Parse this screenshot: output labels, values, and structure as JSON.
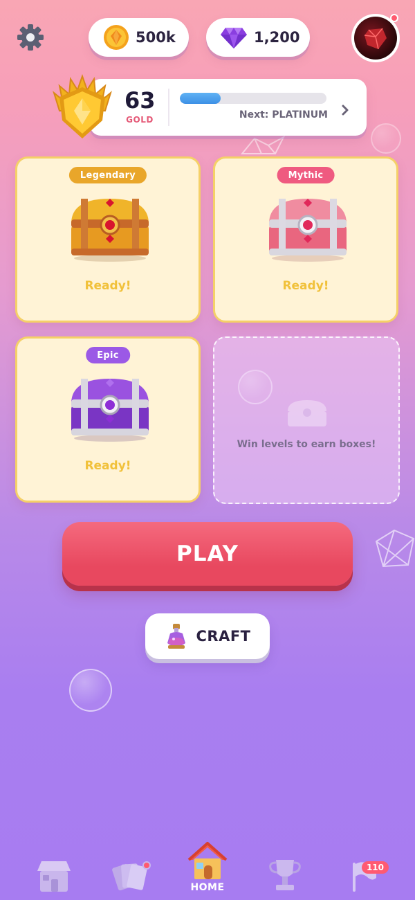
{
  "currency": {
    "coins": "500k",
    "gems": "1,200"
  },
  "rank": {
    "level": "63",
    "tier": "GOLD",
    "progress": 0.28,
    "next_label": "Next: PLATINUM"
  },
  "chests": [
    {
      "rarity": "Legendary",
      "status": "Ready!",
      "tag_color": "#e9a62a"
    },
    {
      "rarity": "Mythic",
      "status": "Ready!",
      "tag_color": "#ef5a80"
    },
    {
      "rarity": "Epic",
      "status": "Ready!",
      "tag_color": "#9b59e6"
    }
  ],
  "empty_slot": {
    "text": "Win levels to earn boxes!"
  },
  "actions": {
    "play": "PLAY",
    "craft": "CRAFT"
  },
  "nav": {
    "home": "HOME",
    "quests_count": "110"
  },
  "icons": [
    "gear-icon",
    "coin-icon",
    "gem-icon",
    "avatar",
    "rank-badge-icon",
    "chevron-right-icon",
    "potion-icon",
    "shop-icon",
    "cards-icon",
    "home-icon",
    "trophy-icon",
    "flag-icon"
  ]
}
